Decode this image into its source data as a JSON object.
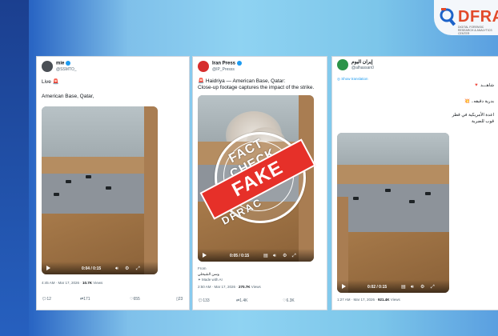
{
  "brand": {
    "name": "DFRA",
    "sub": "DIGITAL FORENSIC RESEARCH & ANALYTICS CENTER",
    "accent": "#e24a2a"
  },
  "posts": [
    {
      "name": "mie",
      "handle": "@SSMTO_",
      "line1": "Live 🚨",
      "line2": "American Base, Qatar,",
      "duration": "0:04 / 0:15",
      "timestamp": "4:45 AM · Mar 17, 2026 · ",
      "views_count": "10.7K",
      "views_label": " Views",
      "replies": "12",
      "reposts": "171",
      "likes": "655",
      "bookmarks": "23"
    },
    {
      "name": "Iran Press",
      "handle": "@IP_Presss",
      "line1": "🚨 Haidriya — American Base, Qatar:",
      "line2": "Close-up footage captures the impact of the strike.",
      "duration": "0:05 / 0:15",
      "from_label": "From",
      "from_name": "وسن الشيخلي",
      "made_with": "Made with AI",
      "timestamp": "2:50 AM · Mar 17, 2026 · ",
      "views_count": "270.7K",
      "views_label": " Views",
      "replies": "133",
      "reposts": "1.4K",
      "likes": "6.3K"
    },
    {
      "name": "إيران اليوم",
      "handle": "@alhassan0",
      "translate": "Show translation",
      "ar1": "شاهـــد 🔻",
      "ar2": "بدرية دقيقه.. 💥",
      "ar3": "اعدة الأمريكية في قطر",
      "ar4": "قوب للضربة",
      "duration": "0:02 / 0:15",
      "timestamp": "1:27 AM · Mar 17, 2026 · ",
      "views_count": "921.4K",
      "views_label": " Views"
    }
  ],
  "stamp": {
    "top": "FACT CHECK",
    "label": "FAKE",
    "bottom": "DFRAC",
    "color": "#e63029"
  }
}
